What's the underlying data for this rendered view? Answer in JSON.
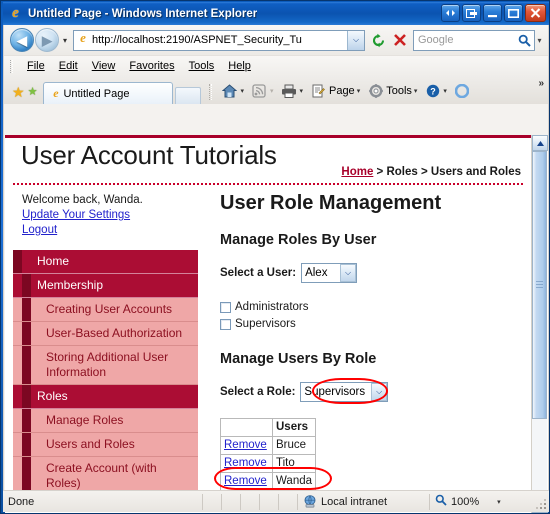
{
  "window": {
    "title": "Untitled Page - Windows Internet Explorer",
    "app_icon": "ie-logo-icon",
    "buttons": {
      "restore_tabs": "restore-tabs-button",
      "minimize_group": "minimize-group-button",
      "minimize": "minimize-button",
      "maximize": "maximize-button",
      "close": "close-button",
      "close_glyph": "✕"
    }
  },
  "navigation": {
    "back_icon": "back-arrow-icon",
    "back_glyph": "◀",
    "forward_icon": "forward-arrow-icon",
    "forward_glyph": "▶",
    "recent_pages_caret": "▾",
    "address": {
      "favicon": "ie-page-icon",
      "url": "http://localhost:2190/ASPNET_Security_Tu",
      "dropdown_caret": "⌵"
    },
    "refresh_icon": "refresh-icon",
    "refresh_glyph": "↺",
    "stop_icon": "stop-icon",
    "stop_glyph": "✕",
    "search": {
      "placeholder": "Google",
      "go_icon": "search-icon",
      "go_glyph": "⚲",
      "provider_caret": "▾"
    }
  },
  "menubar": {
    "items": [
      {
        "label": "File"
      },
      {
        "label": "Edit"
      },
      {
        "label": "View"
      },
      {
        "label": "Favorites"
      },
      {
        "label": "Tools"
      },
      {
        "label": "Help"
      }
    ]
  },
  "tabbar": {
    "favorites_center_icon": "favorites-star-icon",
    "favorites_center_glyph": "★",
    "add_favorite_icon": "add-favorite-star-icon",
    "add_favorite_glyph": "★",
    "tabs": [
      {
        "label": "Untitled Page",
        "favicon": "ie-page-icon",
        "active": true
      }
    ],
    "new_tab_icon": "new-tab-button",
    "toolbar": [
      {
        "name": "home",
        "label": "",
        "icon": "home-icon",
        "glyph": "⌂",
        "caret": "▾"
      },
      {
        "name": "feeds",
        "label": "",
        "icon": "rss-feed-icon",
        "glyph": "◔",
        "caret": "▾"
      },
      {
        "name": "print",
        "label": "",
        "icon": "printer-icon",
        "glyph": "⎙",
        "caret": "▾"
      },
      {
        "name": "page",
        "label": "Page",
        "icon": "page-icon",
        "glyph": "☰",
        "caret": "▾"
      },
      {
        "name": "tools",
        "label": "Tools",
        "icon": "gear-icon",
        "glyph": "⚙",
        "caret": "▾"
      },
      {
        "name": "help",
        "label": "",
        "icon": "help-icon",
        "glyph": "?",
        "caret": "▾"
      },
      {
        "name": "messenger",
        "label": "",
        "icon": "circle-icon",
        "glyph": "●",
        "caret": ""
      }
    ],
    "overflow_glyph": "»"
  },
  "page": {
    "site_title": "User Account Tutorials",
    "breadcrumb": {
      "home_label": "Home",
      "trail": " > Roles > Users and Roles"
    },
    "welcome": {
      "greeting": "Welcome back, Wanda.",
      "settings_link": "Update Your Settings",
      "logout_link": "Logout"
    },
    "nav": [
      {
        "label": "Home",
        "type": "head"
      },
      {
        "label": "Membership",
        "type": "head"
      },
      {
        "label": "Creating User Accounts",
        "type": "sub"
      },
      {
        "label": "User-Based Authorization",
        "type": "sub"
      },
      {
        "label": "Storing Additional User Information",
        "type": "sub"
      },
      {
        "label": "Roles",
        "type": "head"
      },
      {
        "label": "Manage Roles",
        "type": "sub"
      },
      {
        "label": "Users and Roles",
        "type": "sub"
      },
      {
        "label": "Create Account (with Roles)",
        "type": "sub"
      }
    ],
    "main": {
      "heading": "User Role Management",
      "section_user": {
        "heading": "Manage Roles By User",
        "select_label": "Select a User:",
        "selected_user": "Alex",
        "dropdown_caret": "⌵",
        "roles": [
          {
            "label": "Administrators",
            "checked": false
          },
          {
            "label": "Supervisors",
            "checked": false
          }
        ]
      },
      "section_role": {
        "heading": "Manage Users By Role",
        "select_label": "Select a Role:",
        "selected_role": "Supervisors",
        "dropdown_caret": "⌵",
        "table": {
          "headers": [
            "",
            "Users"
          ],
          "action_label": "Remove",
          "rows": [
            {
              "action": "Remove",
              "user": "Bruce"
            },
            {
              "action": "Remove",
              "user": "Tito"
            },
            {
              "action": "Remove",
              "user": "Wanda"
            }
          ]
        }
      }
    },
    "annotations": {
      "color": "#ff0000",
      "role_dropdown_highlight": "oval-around-role-dropdown",
      "wanda_row_highlight": "oval-around-wanda-row"
    },
    "scrollbar": {
      "up_glyph": "▲",
      "down_glyph": "▼"
    }
  },
  "statusbar": {
    "status": "Done",
    "zone_icon": "internet-zone-icon",
    "zone": "Local intranet",
    "zoom_icon": "zoom-icon",
    "zoom_glyph": "⚲",
    "zoom": "100%",
    "zoom_caret": "▾"
  },
  "colors": {
    "brand_dark_red": "#ab0d34",
    "brand_darker_red": "#7c0722",
    "brand_pink": "#efa7a7",
    "link_blue": "#2222cc",
    "annotation_red": "#ff0000",
    "titlebar_blue": "#0f5fc4"
  }
}
